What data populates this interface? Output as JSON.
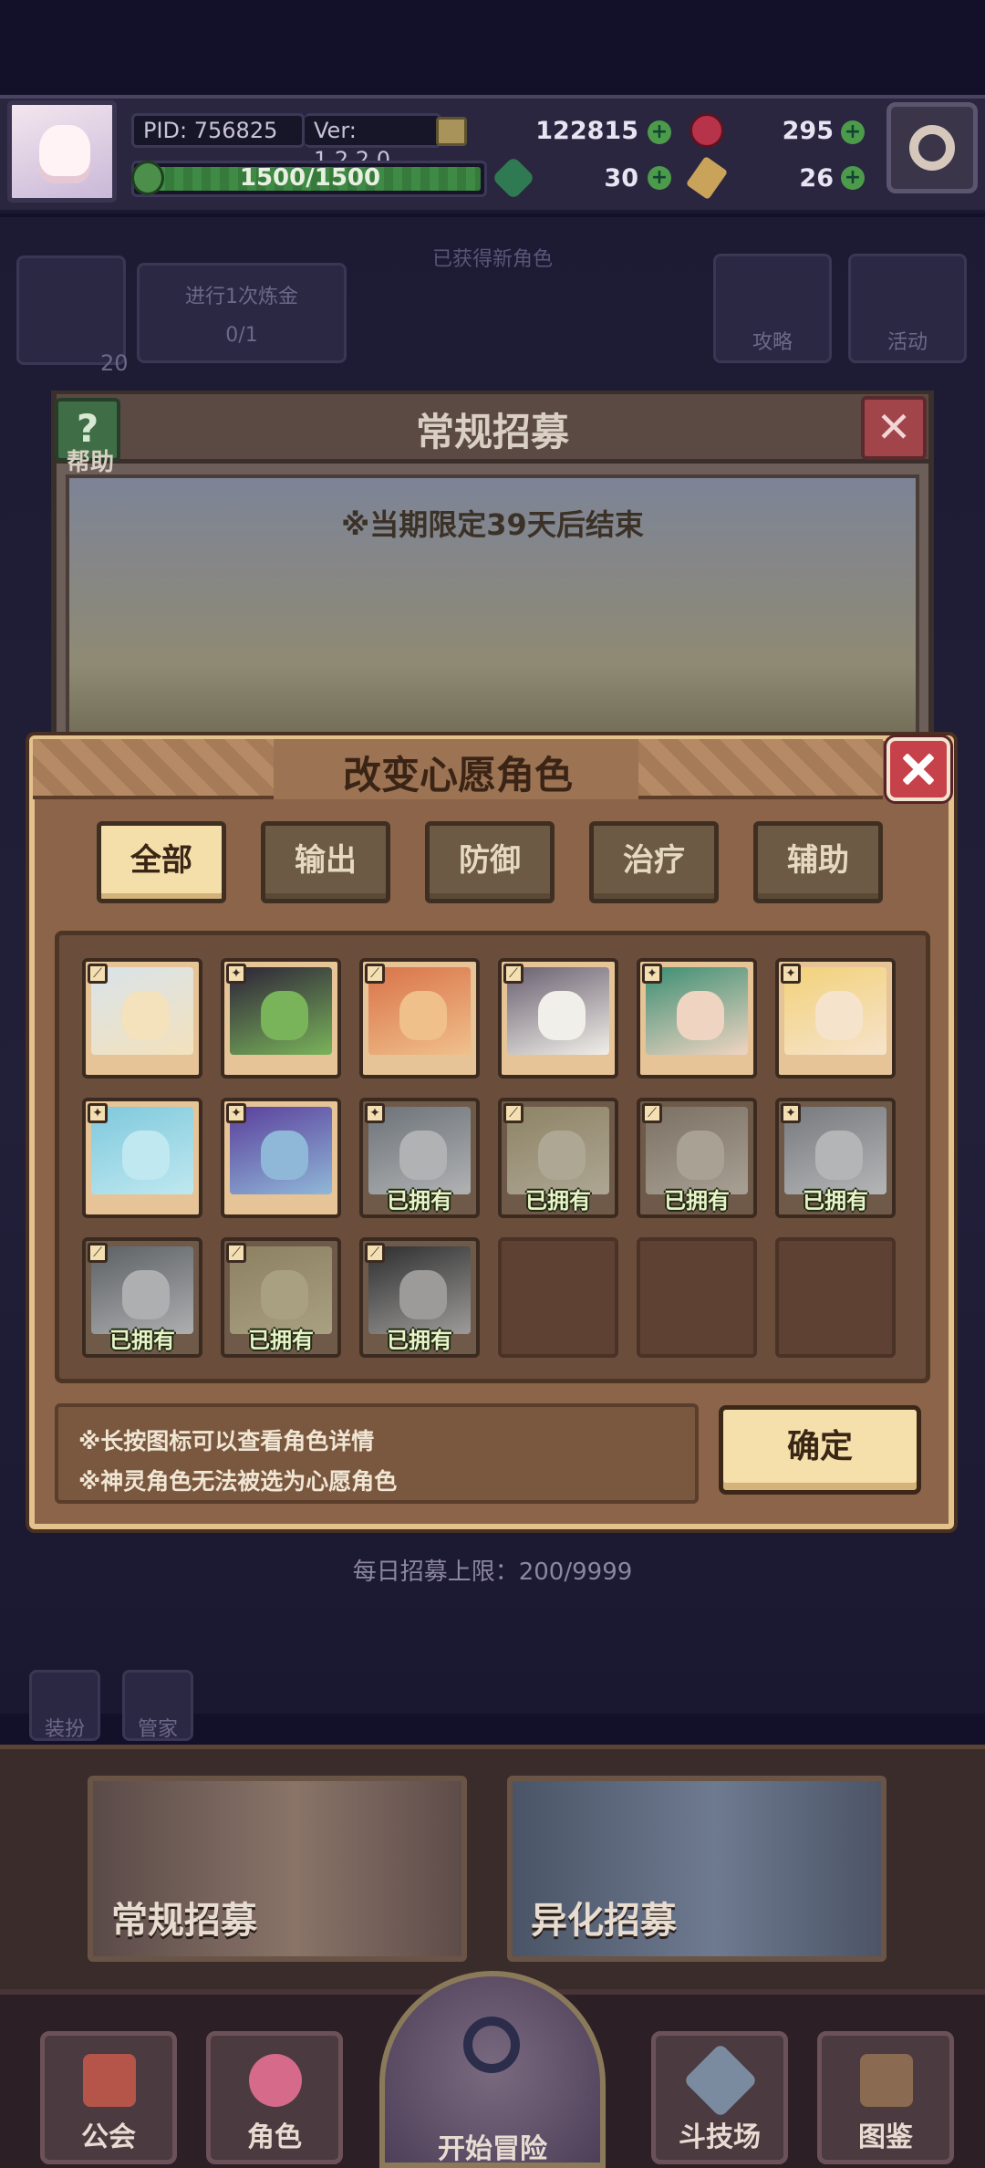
{
  "status": {
    "pid": "PID: 756825",
    "version": "Ver: 1.2.2.0",
    "stamina": "1500/1500",
    "stamina_fraction": 1.0,
    "gold": "122815",
    "gems": "295",
    "clover": "30",
    "keys": "26"
  },
  "background": {
    "task_text": "进行1次炼金",
    "task_progress": "0/1",
    "level_badge": "20",
    "strategy_label": "攻略",
    "activity_label": "活动",
    "ticker": "已获得新角色"
  },
  "recruit_panel": {
    "title": "常规招募",
    "help_label": "帮助",
    "limited_notice": "※当期限定39天后结束",
    "daily_limit": "每日招募上限：200/9999"
  },
  "dialog": {
    "title": "改变心愿角色",
    "tabs": [
      {
        "label": "全部",
        "active": true
      },
      {
        "label": "输出",
        "active": false
      },
      {
        "label": "防御",
        "active": false
      },
      {
        "label": "治疗",
        "active": false
      },
      {
        "label": "辅助",
        "active": false
      }
    ],
    "owned_label": "已拥有",
    "characters": [
      {
        "name": "character-1",
        "owned": false,
        "role_icon": "sword-icon",
        "palette": [
          "#d9e3ea",
          "#f3e2bc"
        ]
      },
      {
        "name": "character-2",
        "owned": false,
        "role_icon": "star-icon",
        "palette": [
          "#2e2338",
          "#79b35a"
        ]
      },
      {
        "name": "character-3",
        "owned": false,
        "role_icon": "sword-icon",
        "palette": [
          "#d9734a",
          "#f0c08b"
        ]
      },
      {
        "name": "character-4",
        "owned": false,
        "role_icon": "sword-icon",
        "palette": [
          "#6a6070",
          "#f1efe9"
        ]
      },
      {
        "name": "character-5",
        "owned": false,
        "role_icon": "star-icon",
        "palette": [
          "#3c8f73",
          "#f0d4c2"
        ]
      },
      {
        "name": "character-6",
        "owned": false,
        "role_icon": "star-icon",
        "palette": [
          "#f2d27a",
          "#f6e3cc"
        ]
      },
      {
        "name": "character-7",
        "owned": false,
        "role_icon": "star-icon",
        "palette": [
          "#7fc9dc",
          "#bfe8f0"
        ]
      },
      {
        "name": "character-8",
        "owned": false,
        "role_icon": "star-icon",
        "palette": [
          "#5b3f9c",
          "#8fb8d8"
        ]
      },
      {
        "name": "character-9",
        "owned": true,
        "role_icon": "star-icon",
        "palette": [
          "#7c92a8",
          "#d9dfe6"
        ]
      },
      {
        "name": "character-10",
        "owned": true,
        "role_icon": "sword-icon",
        "palette": [
          "#c9a43b",
          "#e9d08a"
        ]
      },
      {
        "name": "character-11",
        "owned": true,
        "role_icon": "sword-icon",
        "palette": [
          "#b08a5a",
          "#e2c79a"
        ]
      },
      {
        "name": "character-12",
        "owned": true,
        "role_icon": "star-icon",
        "palette": [
          "#8f9aa8",
          "#dfe3e8"
        ]
      },
      {
        "name": "character-13",
        "owned": true,
        "role_icon": "sword-icon",
        "palette": [
          "#6d7a88",
          "#d5dbe0"
        ]
      },
      {
        "name": "character-14",
        "owned": true,
        "role_icon": "sword-icon",
        "palette": [
          "#c9a02e",
          "#e9c95e"
        ]
      },
      {
        "name": "character-15",
        "owned": true,
        "role_icon": "sword-icon",
        "palette": [
          "#3b3a40",
          "#c8c2b8"
        ]
      }
    ],
    "empty_slots": 3,
    "notes": [
      "※长按图标可以查看角色详情",
      "※神灵角色无法被选为心愿角色"
    ],
    "confirm_label": "确定"
  },
  "bottom": {
    "side_labels": [
      "装扮",
      "管家"
    ],
    "banners": [
      {
        "label": "常规招募"
      },
      {
        "label": "异化招募"
      }
    ],
    "nav": [
      {
        "label": "公会",
        "icon": "guild-icon"
      },
      {
        "label": "角色",
        "icon": "character-icon"
      },
      {
        "label": "开始冒险",
        "icon": "magnifier-icon"
      },
      {
        "label": "斗技场",
        "icon": "crossed-swords-icon"
      },
      {
        "label": "图鉴",
        "icon": "codex-icon"
      }
    ]
  },
  "colors": {
    "dialog_bg": "#8b6449",
    "dialog_border": "#e3c28d",
    "tab_active": "#f4dfab",
    "owned_text": "#e8f3c8",
    "close_red": "#c7414a"
  }
}
